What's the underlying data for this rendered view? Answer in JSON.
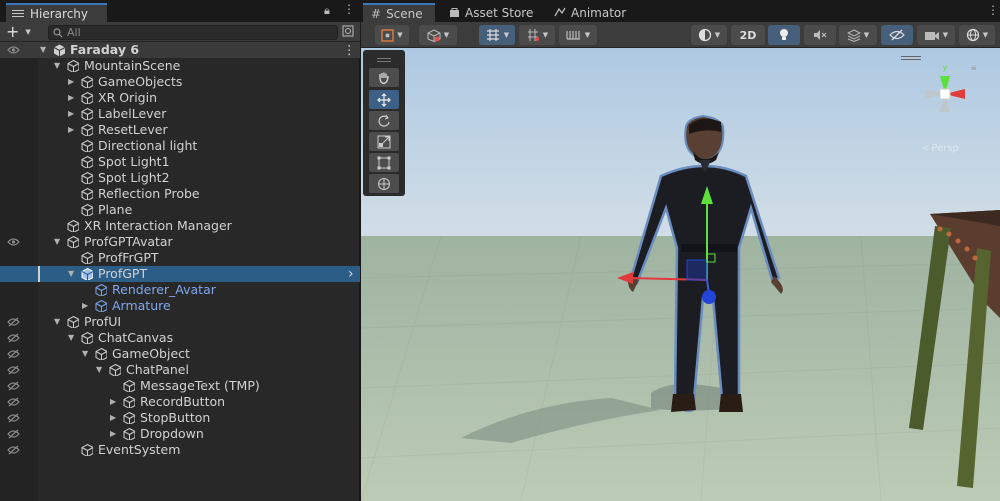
{
  "hierarchy": {
    "tab_label": "Hierarchy",
    "search_placeholder": "All",
    "rows": [
      {
        "label": "Faraday 6",
        "depth": 0,
        "arrow": "down",
        "kind": "scene",
        "bold": true,
        "eye": true
      },
      {
        "label": "MountainScene",
        "depth": 1,
        "arrow": "down"
      },
      {
        "label": "GameObjects",
        "depth": 2,
        "arrow": "right"
      },
      {
        "label": "XR Origin",
        "depth": 2,
        "arrow": "right"
      },
      {
        "label": "LabelLever",
        "depth": 2,
        "arrow": "right"
      },
      {
        "label": "ResetLever",
        "depth": 2,
        "arrow": "right"
      },
      {
        "label": "Directional light",
        "depth": 2,
        "arrow": ""
      },
      {
        "label": "Spot Light1",
        "depth": 2,
        "arrow": ""
      },
      {
        "label": "Spot Light2",
        "depth": 2,
        "arrow": ""
      },
      {
        "label": "Reflection Probe",
        "depth": 2,
        "arrow": ""
      },
      {
        "label": "Plane",
        "depth": 2,
        "arrow": ""
      },
      {
        "label": "XR Interaction Manager",
        "depth": 1,
        "arrow": ""
      },
      {
        "label": "ProfGPTAvatar",
        "depth": 1,
        "arrow": "down",
        "eye": true
      },
      {
        "label": "ProfFrGPT",
        "depth": 2,
        "arrow": ""
      },
      {
        "label": "ProfGPT",
        "depth": 2,
        "arrow": "down",
        "selected": true
      },
      {
        "label": "Renderer_Avatar",
        "depth": 3,
        "arrow": "",
        "blue": true
      },
      {
        "label": "Armature",
        "depth": 3,
        "arrow": "right",
        "blue": true
      },
      {
        "label": "ProfUI",
        "depth": 1,
        "arrow": "down",
        "hidden": true
      },
      {
        "label": "ChatCanvas",
        "depth": 2,
        "arrow": "down",
        "hidden": true
      },
      {
        "label": "GameObject",
        "depth": 3,
        "arrow": "down",
        "hidden": true
      },
      {
        "label": "ChatPanel",
        "depth": 4,
        "arrow": "down",
        "hidden": true
      },
      {
        "label": "MessageText (TMP)",
        "depth": 5,
        "arrow": "",
        "hidden": true
      },
      {
        "label": "RecordButton",
        "depth": 5,
        "arrow": "right",
        "hidden": true
      },
      {
        "label": "StopButton",
        "depth": 5,
        "arrow": "right",
        "hidden": true
      },
      {
        "label": "Dropdown",
        "depth": 5,
        "arrow": "right",
        "hidden": true
      },
      {
        "label": "EventSystem",
        "depth": 2,
        "arrow": "",
        "hidden": true
      }
    ]
  },
  "scene_tabs": [
    {
      "label": "Scene",
      "icon": "hash-icon"
    },
    {
      "label": "Asset Store",
      "icon": "bag-icon"
    },
    {
      "label": "Animator",
      "icon": "animator-icon"
    }
  ],
  "scene_toolbar": {
    "mode_2d_label": "2D"
  },
  "gizmo": {
    "view_label": "Persp"
  },
  "colors": {
    "selection": "#2c5d87",
    "accent": "#3a79bb",
    "prefab_blue": "#7ea7f0",
    "sky": "#c8d8e6",
    "ground": "#a8b8a0"
  }
}
